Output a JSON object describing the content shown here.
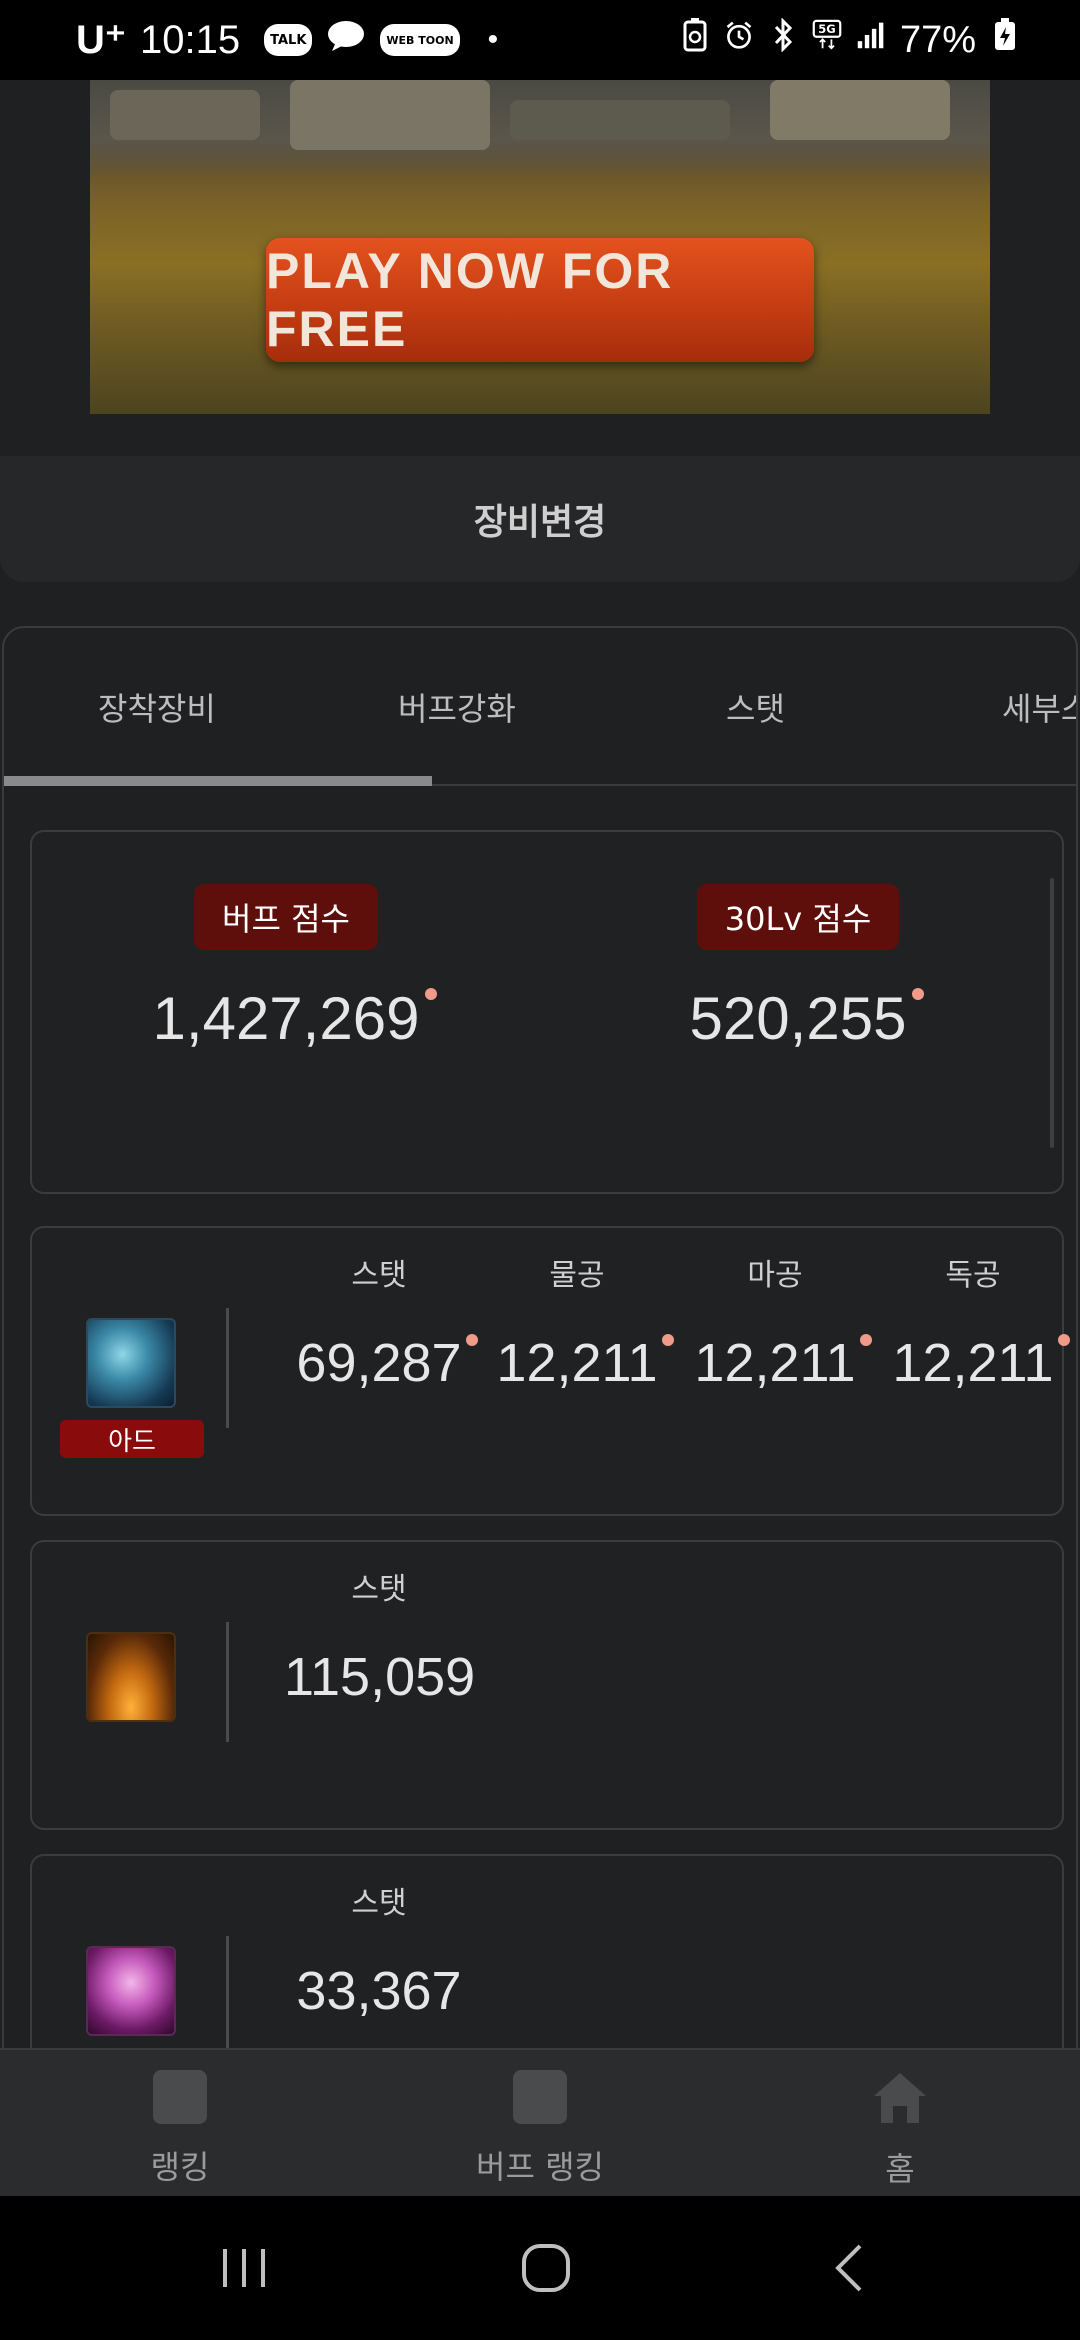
{
  "status_bar": {
    "carrier": "U⁺",
    "time": "10:15",
    "badges": [
      "TALK",
      "WEB TOON"
    ],
    "battery": "77%"
  },
  "banner": {
    "cta": "PLAY NOW FOR FREE"
  },
  "equipment": {
    "title": "장비변경"
  },
  "tabs": [
    {
      "label": "장착장비",
      "active": true
    },
    {
      "label": "버프강화",
      "active": false
    },
    {
      "label": "스탯",
      "active": false
    },
    {
      "label": "세부스",
      "active": false
    }
  ],
  "scores": {
    "buff_score_label": "버프 점수",
    "buff_score_value": "1,427,269",
    "lv30_score_label": "30Lv 점수",
    "lv30_score_value": "520,255"
  },
  "stat_rows": [
    {
      "badge": "아드",
      "labels": [
        "스탯",
        "물공",
        "마공",
        "독공"
      ],
      "values": [
        "69,287",
        "12,211",
        "12,211",
        "12,211"
      ]
    },
    {
      "labels": [
        "스탯"
      ],
      "values": [
        "115,059"
      ]
    },
    {
      "labels": [
        "스탯"
      ],
      "values": [
        "33,367"
      ]
    }
  ],
  "bottom_nav": [
    {
      "label": "랭킹",
      "icon": "square-icon"
    },
    {
      "label": "버프 랭킹",
      "icon": "square-icon"
    },
    {
      "label": "홈",
      "icon": "home-icon"
    }
  ],
  "colors": {
    "background": "#1f2022",
    "score_badge": "#5e0f0c",
    "change_dot": "#f09a8a",
    "cta": "#c23b12"
  }
}
